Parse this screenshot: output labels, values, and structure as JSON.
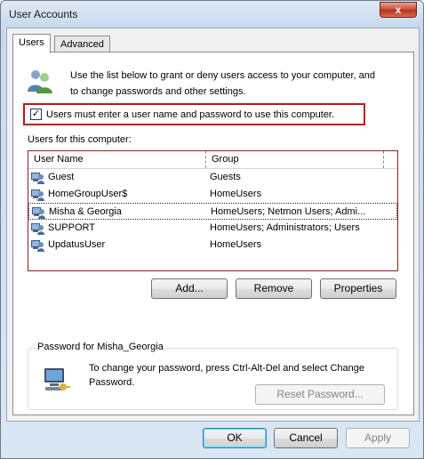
{
  "window": {
    "title": "User Accounts",
    "close_glyph": "x"
  },
  "tabs": [
    {
      "label": "Users",
      "active": true
    },
    {
      "label": "Advanced",
      "active": false
    }
  ],
  "intro_text": "Use the list below to grant or deny users access to your computer, and to change passwords and other settings.",
  "require_login": {
    "label": "Users must enter a user name and password to use this computer.",
    "checked": true,
    "check_glyph": "✓"
  },
  "users_list": {
    "label": "Users for this computer:",
    "columns": [
      "User Name",
      "Group"
    ],
    "rows": [
      {
        "name": "Guest",
        "group": "Guests",
        "selected": false
      },
      {
        "name": "HomeGroupUser$",
        "group": "HomeUsers",
        "selected": false
      },
      {
        "name": "Misha & Georgia",
        "group": "HomeUsers; Netmon Users; Admi...",
        "selected": true
      },
      {
        "name": "SUPPORT",
        "group": "HomeUsers; Administrators; Users",
        "selected": false
      },
      {
        "name": "UpdatusUser",
        "group": "HomeUsers",
        "selected": false
      }
    ]
  },
  "list_buttons": {
    "add": "Add...",
    "remove": "Remove",
    "properties": "Properties"
  },
  "password_group": {
    "title": "Password for Misha_Georgia",
    "text": "To change your password, press Ctrl-Alt-Del and select Change Password.",
    "reset_button": "Reset Password..."
  },
  "dialog_buttons": {
    "ok": "OK",
    "cancel": "Cancel",
    "apply": "Apply"
  },
  "colors": {
    "highlight_border": "#c0141c",
    "title_bar": "#c9daee",
    "close_button": "#c7452e"
  },
  "icons": [
    "users-icon",
    "user-icon",
    "computer-key-icon",
    "close-icon",
    "checkbox-check-icon"
  ]
}
